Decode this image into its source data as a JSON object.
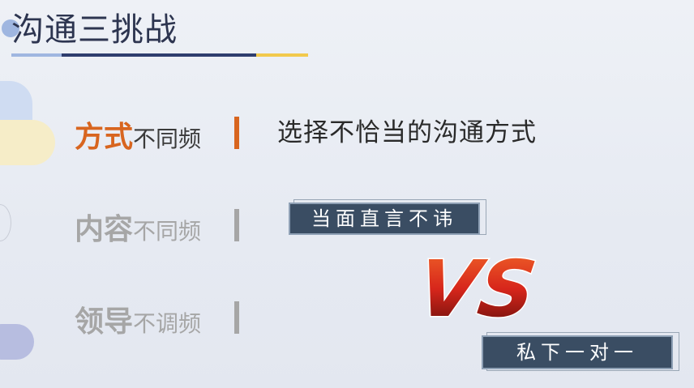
{
  "slide": {
    "title": "沟通三挑战",
    "rows": [
      {
        "big": "方式",
        "small": "不同频",
        "active": true
      },
      {
        "big": "内容",
        "small": "不同频",
        "active": false
      },
      {
        "big": "领导",
        "small": "不调频",
        "active": false
      }
    ],
    "description": "选择不恰当的沟通方式",
    "tag_top": "当面直言不讳",
    "tag_bottom": "私下一对一",
    "vs_text": "VS"
  },
  "colors": {
    "accent": "#d8651f",
    "inactive": "#a6a6a6",
    "tag_bg": "#3a4d63",
    "title": "#2d3550",
    "underline_blue": "#2e3d6e",
    "underline_yellow": "#f2c94c",
    "vs_red": "#d7261b"
  }
}
